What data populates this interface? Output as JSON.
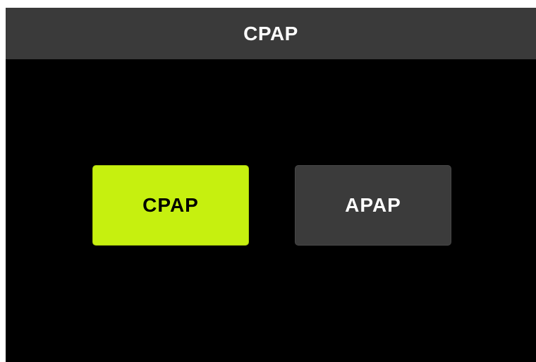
{
  "header": {
    "title": "CPAP"
  },
  "modes": {
    "cpap": {
      "label": "CPAP",
      "selected": true,
      "color": "#c6f00f"
    },
    "apap": {
      "label": "APAP",
      "selected": false,
      "color": "#3b3b3b"
    }
  }
}
